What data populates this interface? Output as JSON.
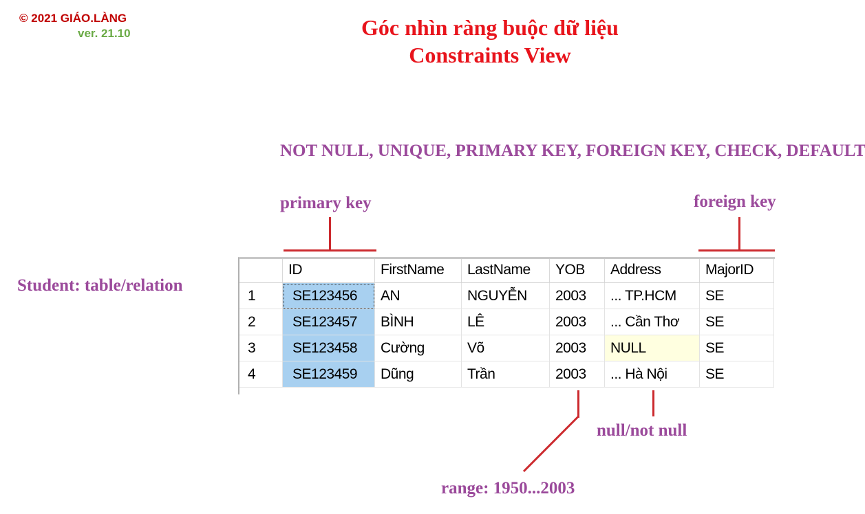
{
  "brand": {
    "copyright": "© 2021 GIÁO.LÀNG",
    "version": "ver. 21.10"
  },
  "title": {
    "line1": "Góc nhìn ràng buộc dữ liệu",
    "line2": "Constraints View"
  },
  "labels": {
    "constraints": "NOT NULL, UNIQUE, PRIMARY KEY, FOREIGN KEY, CHECK, DEFAULT",
    "primary_key": "primary key",
    "foreign_key": "foreign key",
    "table": "Student: table/relation",
    "null_not_null": "null/not null",
    "range": "range: 1950...2003"
  },
  "grid": {
    "columns": [
      "ID",
      "FirstName",
      "LastName",
      "YOB",
      "Address",
      "MajorID"
    ],
    "rows": [
      {
        "num": "1",
        "ID": "SE123456",
        "FirstName": "AN",
        "LastName": "NGUYỄN",
        "YOB": "2003",
        "Address": "... TP.HCM",
        "MajorID": "SE"
      },
      {
        "num": "2",
        "ID": "SE123457",
        "FirstName": "BÌNH",
        "LastName": "LÊ",
        "YOB": "2003",
        "Address": "... Cần Thơ",
        "MajorID": "SE"
      },
      {
        "num": "3",
        "ID": "SE123458",
        "FirstName": "Cường",
        "LastName": "Võ",
        "YOB": "2003",
        "Address": "NULL",
        "MajorID": "SE"
      },
      {
        "num": "4",
        "ID": "SE123459",
        "FirstName": "Dũng",
        "LastName": "Trần",
        "YOB": "2003",
        "Address": "... Hà Nội",
        "MajorID": "SE"
      }
    ]
  },
  "colors": {
    "title": "#e8141c",
    "annotation": "#9b4a9b",
    "pointer_line": "#cc2a2e",
    "primary_key_fill": "#a8d0f0",
    "null_fill": "#ffffe0"
  }
}
